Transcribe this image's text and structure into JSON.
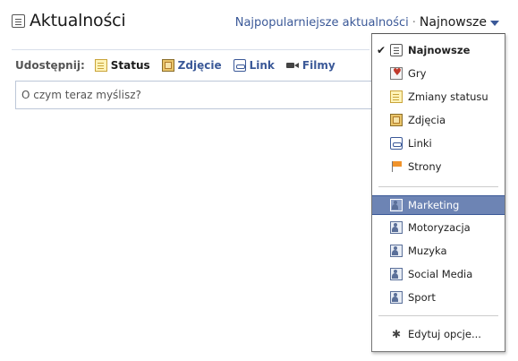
{
  "header": {
    "title": "Aktualności",
    "sort_popular": "Najpopularniejsze aktualności",
    "sort_separator": "·",
    "sort_active": "Najnowsze"
  },
  "share": {
    "label": "Udostępnij:",
    "items": [
      {
        "label": "Status",
        "icon": "status-icon"
      },
      {
        "label": "Zdjęcie",
        "icon": "photo-icon"
      },
      {
        "label": "Link",
        "icon": "link-icon"
      },
      {
        "label": "Filmy",
        "icon": "video-icon"
      }
    ]
  },
  "composer": {
    "placeholder": "O czym teraz myślisz?"
  },
  "dropdown": {
    "check_mark": "✔",
    "items": [
      {
        "label": "Najnowsze",
        "icon": "news-feed-icon",
        "checked": true
      },
      {
        "label": "Gry",
        "icon": "games-icon"
      },
      {
        "label": "Zmiany statusu",
        "icon": "status-icon"
      },
      {
        "label": "Zdjęcia",
        "icon": "photo-icon"
      },
      {
        "label": "Linki",
        "icon": "link-icon"
      },
      {
        "label": "Strony",
        "icon": "pages-flag-icon"
      }
    ],
    "lists": [
      {
        "label": "Marketing",
        "icon": "friend-list-icon",
        "highlighted": true
      },
      {
        "label": "Motoryzacja",
        "icon": "friend-list-icon"
      },
      {
        "label": "Muzyka",
        "icon": "friend-list-icon"
      },
      {
        "label": "Social Media",
        "icon": "friend-list-icon"
      },
      {
        "label": "Sport",
        "icon": "friend-list-icon"
      }
    ],
    "edit_label": "Edytuj opcje...",
    "gear_glyph": "✱"
  },
  "colors": {
    "link": "#3b5998",
    "highlight": "#6d84b4"
  }
}
